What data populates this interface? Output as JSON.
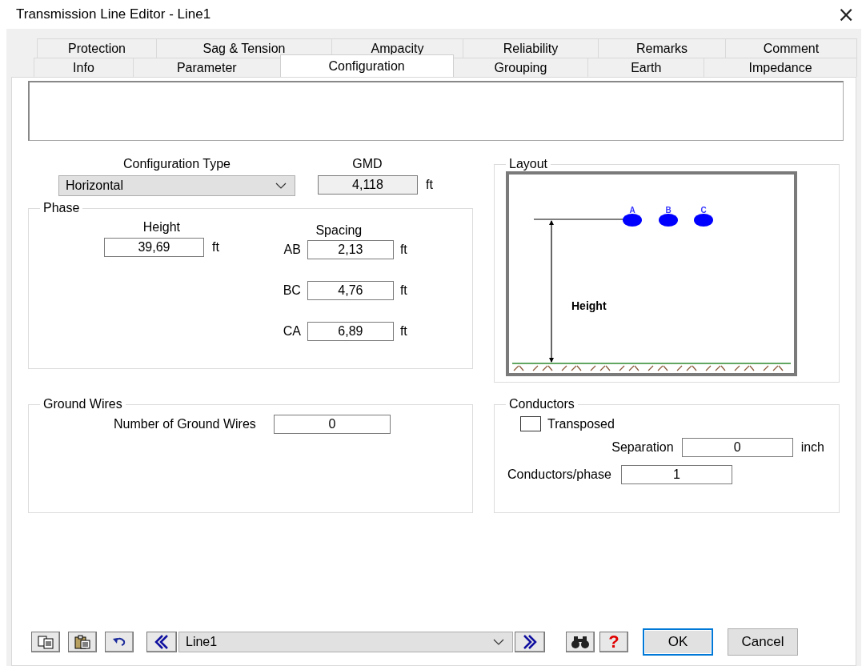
{
  "window": {
    "title": "Transmission Line Editor - Line1",
    "close": "×"
  },
  "tab_rows": [
    {
      "tabs": [
        {
          "label": "Protection",
          "selected": false
        },
        {
          "label": "Sag & Tension",
          "selected": false
        },
        {
          "label": "Ampacity",
          "selected": false
        },
        {
          "label": "Reliability",
          "selected": false
        },
        {
          "label": "Remarks",
          "selected": false
        },
        {
          "label": "Comment",
          "selected": false
        }
      ]
    },
    {
      "tabs": [
        {
          "label": "Info",
          "selected": false
        },
        {
          "label": "Parameter",
          "selected": false
        },
        {
          "label": "Configuration",
          "selected": true
        },
        {
          "label": "Grouping",
          "selected": false
        },
        {
          "label": "Earth",
          "selected": false
        },
        {
          "label": "Impedance",
          "selected": false
        }
      ]
    }
  ],
  "configuration_type": {
    "label": "Configuration Type",
    "value": "Horizontal"
  },
  "gmd": {
    "label": "GMD",
    "value": "4,118",
    "unit": "ft"
  },
  "phase": {
    "title": "Phase",
    "height": {
      "label": "Height",
      "value": "39,69",
      "unit": "ft"
    },
    "spacing": {
      "label": "Spacing",
      "rows": [
        {
          "label": "AB",
          "value": "2,13",
          "unit": "ft"
        },
        {
          "label": "BC",
          "value": "4,76",
          "unit": "ft"
        },
        {
          "label": "CA",
          "value": "6,89",
          "unit": "ft"
        }
      ]
    }
  },
  "layout": {
    "title": "Layout",
    "phases": [
      "A",
      "B",
      "C"
    ],
    "dimension_label": "Height"
  },
  "ground_wires": {
    "title": "Ground Wires",
    "label": "Number of Ground Wires",
    "value": "0"
  },
  "conductors": {
    "title": "Conductors",
    "transposed": {
      "label": "Transposed",
      "checked": false
    },
    "separation": {
      "label": "Separation",
      "value": "0",
      "unit": "inch"
    },
    "per_phase": {
      "label": "Conductors/phase",
      "value": "1"
    }
  },
  "toolbar": {
    "record": "Line1",
    "help": "?",
    "ok": "OK",
    "cancel": "Cancel"
  }
}
